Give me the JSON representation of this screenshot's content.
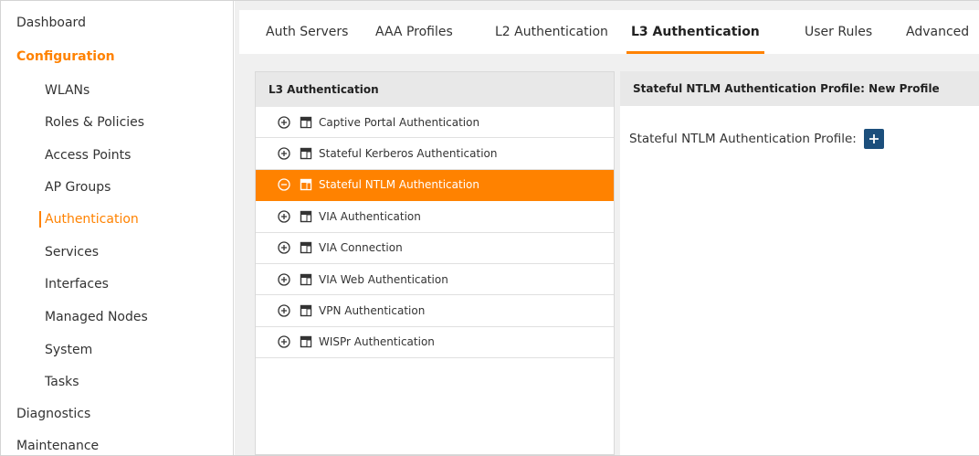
{
  "sidebar": {
    "dashboard": "Dashboard",
    "configuration": "Configuration",
    "items": [
      {
        "label": "WLANs"
      },
      {
        "label": "Roles & Policies"
      },
      {
        "label": "Access Points"
      },
      {
        "label": "AP Groups"
      },
      {
        "label": "Authentication"
      },
      {
        "label": "Services"
      },
      {
        "label": "Interfaces"
      },
      {
        "label": "Managed Nodes"
      },
      {
        "label": "System"
      },
      {
        "label": "Tasks"
      }
    ],
    "diagnostics": "Diagnostics",
    "maintenance": "Maintenance",
    "active_item": "Authentication"
  },
  "tabs": [
    {
      "label": "Auth Servers"
    },
    {
      "label": "AAA Profiles"
    },
    {
      "label": "L2 Authentication"
    },
    {
      "label": "L3 Authentication"
    },
    {
      "label": "User Rules"
    },
    {
      "label": "Advanced"
    }
  ],
  "active_tab": "L3 Authentication",
  "left_panel": {
    "title": "L3 Authentication",
    "items": [
      {
        "label": "Captive Portal Authentication",
        "expanded": false
      },
      {
        "label": "Stateful Kerberos Authentication",
        "expanded": false
      },
      {
        "label": "Stateful NTLM Authentication",
        "expanded": true
      },
      {
        "label": "VIA Authentication",
        "expanded": false
      },
      {
        "label": "VIA Connection",
        "expanded": false
      },
      {
        "label": "VIA Web Authentication",
        "expanded": false
      },
      {
        "label": "VPN Authentication",
        "expanded": false
      },
      {
        "label": "WISPr Authentication",
        "expanded": false
      }
    ],
    "selected": "Stateful NTLM Authentication"
  },
  "right_panel": {
    "title": "Stateful NTLM Authentication Profile: New Profile",
    "field_label": "Stateful NTLM Authentication Profile:",
    "add_icon": "plus-icon"
  },
  "colors": {
    "accent": "#ff8200",
    "button": "#1c4f7c"
  }
}
